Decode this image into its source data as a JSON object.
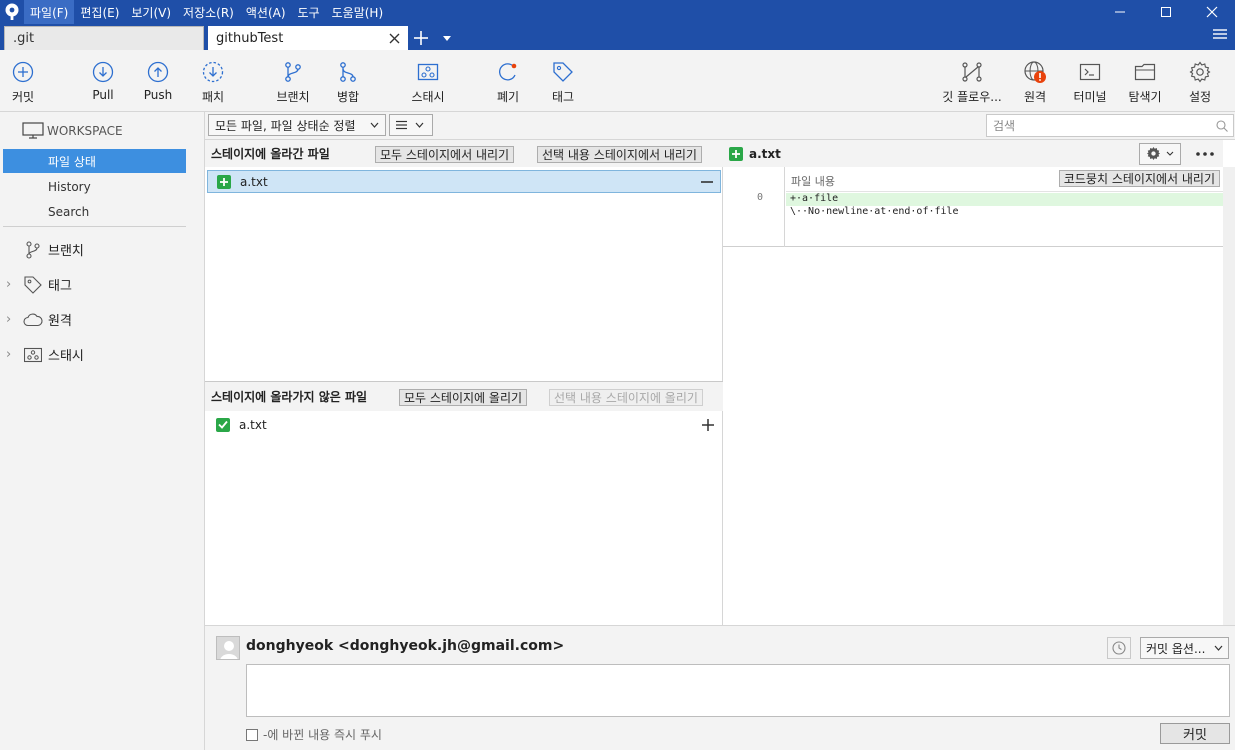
{
  "menu": {
    "items": [
      "파일(F)",
      "편집(E)",
      "보기(V)",
      "저장소(R)",
      "액션(A)",
      "도구",
      "도움말(H)"
    ]
  },
  "tabs": {
    "inactive_label": ".git",
    "active_label": "githubTest"
  },
  "toolbar": {
    "commit": "커밋",
    "pull": "Pull",
    "push": "Push",
    "fetch": "패치",
    "branch": "브랜치",
    "merge": "병합",
    "stash": "스태시",
    "discard": "폐기",
    "tag": "태그",
    "gitflow": "깃 플로우...",
    "remote": "원격",
    "terminal": "터미널",
    "explorer": "탐색기",
    "settings": "설정"
  },
  "sidebar": {
    "workspace": "WORKSPACE",
    "file_status": "파일 상태",
    "history": "History",
    "search": "Search",
    "branches": "브랜치",
    "tags": "태그",
    "remotes": "원격",
    "stashes": "스태시"
  },
  "filter": {
    "sort_label": "모든 파일, 파일 상태순 정렬",
    "search_placeholder": "검색"
  },
  "staged": {
    "title": "스테이지에 올라간 파일",
    "unstage_all": "모두 스테이지에서 내리기",
    "unstage_selected": "선택 내용 스테이지에서 내리기",
    "files": [
      "a.txt"
    ]
  },
  "unstaged": {
    "title": "스테이지에 올라가지 않은 파일",
    "stage_all": "모두 스테이지에 올리기",
    "stage_selected": "선택 내용 스테이지에 올리기",
    "files": [
      "a.txt"
    ]
  },
  "diff": {
    "filename": "a.txt",
    "hunk_header": "파일 내용",
    "hunk_action": "코드뭉치 스테이지에서 내리기",
    "line_no": "0",
    "lines": [
      "+·a·file",
      "\\··No·newline·at·end·of·file"
    ]
  },
  "commit": {
    "author": "donghyeok <donghyeok.jh@gmail.com>",
    "options": "커밋 옵션...",
    "push_immediately": "-에 바뀐 내용 즉시 푸시",
    "commit_button": "커밋"
  },
  "colors": {
    "titlebar": "#1f4fa8",
    "selection": "#3d8fe0",
    "added": "#2aa748",
    "diff_add_bg": "#dff7df",
    "warning": "#e8420c"
  }
}
